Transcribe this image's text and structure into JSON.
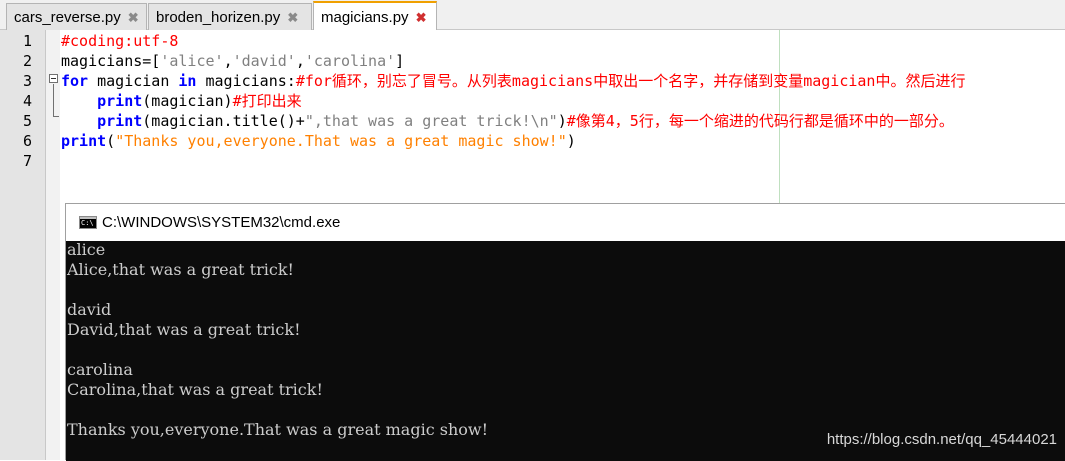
{
  "tabs": [
    {
      "label": "cars_reverse.py",
      "active": false
    },
    {
      "label": "broden_horizen.py",
      "active": false
    },
    {
      "label": "magicians.py",
      "active": true
    }
  ],
  "close_icon": "close-icon",
  "editor": {
    "line_numbers": [
      "1",
      "2",
      "3",
      "4",
      "5",
      "6",
      "7"
    ],
    "lines": [
      [
        {
          "t": "cmt",
          "v": "#coding:utf-8"
        }
      ],
      [
        {
          "t": "",
          "v": "magicians=["
        },
        {
          "t": "str",
          "v": "'alice'"
        },
        {
          "t": "",
          "v": ","
        },
        {
          "t": "str",
          "v": "'david'"
        },
        {
          "t": "",
          "v": ","
        },
        {
          "t": "str",
          "v": "'carolina'"
        },
        {
          "t": "",
          "v": "]"
        }
      ],
      [
        {
          "t": "kw",
          "v": "for"
        },
        {
          "t": "",
          "v": " magician "
        },
        {
          "t": "kw",
          "v": "in"
        },
        {
          "t": "",
          "v": " magicians:"
        },
        {
          "t": "cmt",
          "v": "#for循环，别忘了冒号。从列表magicians中取出一个名字，并存储到变量magician中。然后进行"
        }
      ],
      [
        {
          "t": "",
          "v": "    "
        },
        {
          "t": "kw",
          "v": "print"
        },
        {
          "t": "",
          "v": "(magician)"
        },
        {
          "t": "cmt",
          "v": "#打印出来"
        }
      ],
      [
        {
          "t": "",
          "v": "    "
        },
        {
          "t": "kw",
          "v": "print"
        },
        {
          "t": "",
          "v": "(magician.title()+"
        },
        {
          "t": "str",
          "v": "\",that was a great trick!\\n\""
        },
        {
          "t": "",
          "v": ")"
        },
        {
          "t": "cmt",
          "v": "#像第4，5行，每一个缩进的代码行都是循环中的一部分。"
        }
      ],
      [
        {
          "t": "kw",
          "v": "print"
        },
        {
          "t": "",
          "v": "("
        },
        {
          "t": "ostr",
          "v": "\"Thanks you,everyone.That was a great magic show!\""
        },
        {
          "t": "",
          "v": ")"
        }
      ],
      []
    ]
  },
  "cmd": {
    "title": "C:\\WINDOWS\\SYSTEM32\\cmd.exe",
    "icon_text": "C:\\",
    "output": [
      "alice",
      "Alice,that was a great trick!",
      "",
      "david",
      "David,that was a great trick!",
      "",
      "carolina",
      "Carolina,that was a great trick!",
      "",
      "Thanks you,everyone.That was a great magic show!"
    ]
  },
  "watermark": "https://blog.csdn.net/qq_45444021"
}
